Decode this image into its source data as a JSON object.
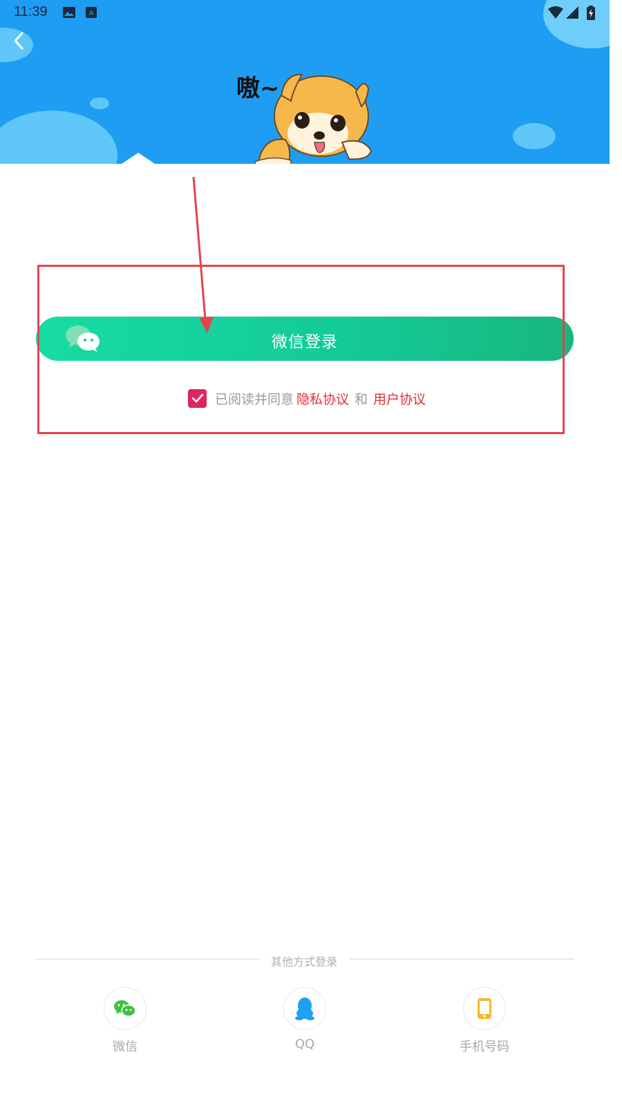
{
  "status_bar": {
    "time": "11:39"
  },
  "header": {
    "bark_text": "嗷~",
    "back_icon": "chevron-left-icon"
  },
  "login": {
    "wechat_button_label": "微信登录",
    "agreement": {
      "checked": true,
      "prefix": "已阅读并同意",
      "privacy_link": "隐私协议",
      "conjunction": "和",
      "user_link": "用户协议"
    }
  },
  "other_methods": {
    "title": "其他方式登录",
    "items": [
      {
        "label": "微信",
        "icon": "wechat-icon"
      },
      {
        "label": "QQ",
        "icon": "qq-penguin-icon"
      },
      {
        "label": "手机号码",
        "icon": "phone-icon"
      }
    ]
  },
  "colors": {
    "banner": "#1e9df2",
    "wechat_button": "#14c996",
    "checkbox": "#e0245e",
    "link": "#e62e3a",
    "annotation": "#e8424a"
  }
}
